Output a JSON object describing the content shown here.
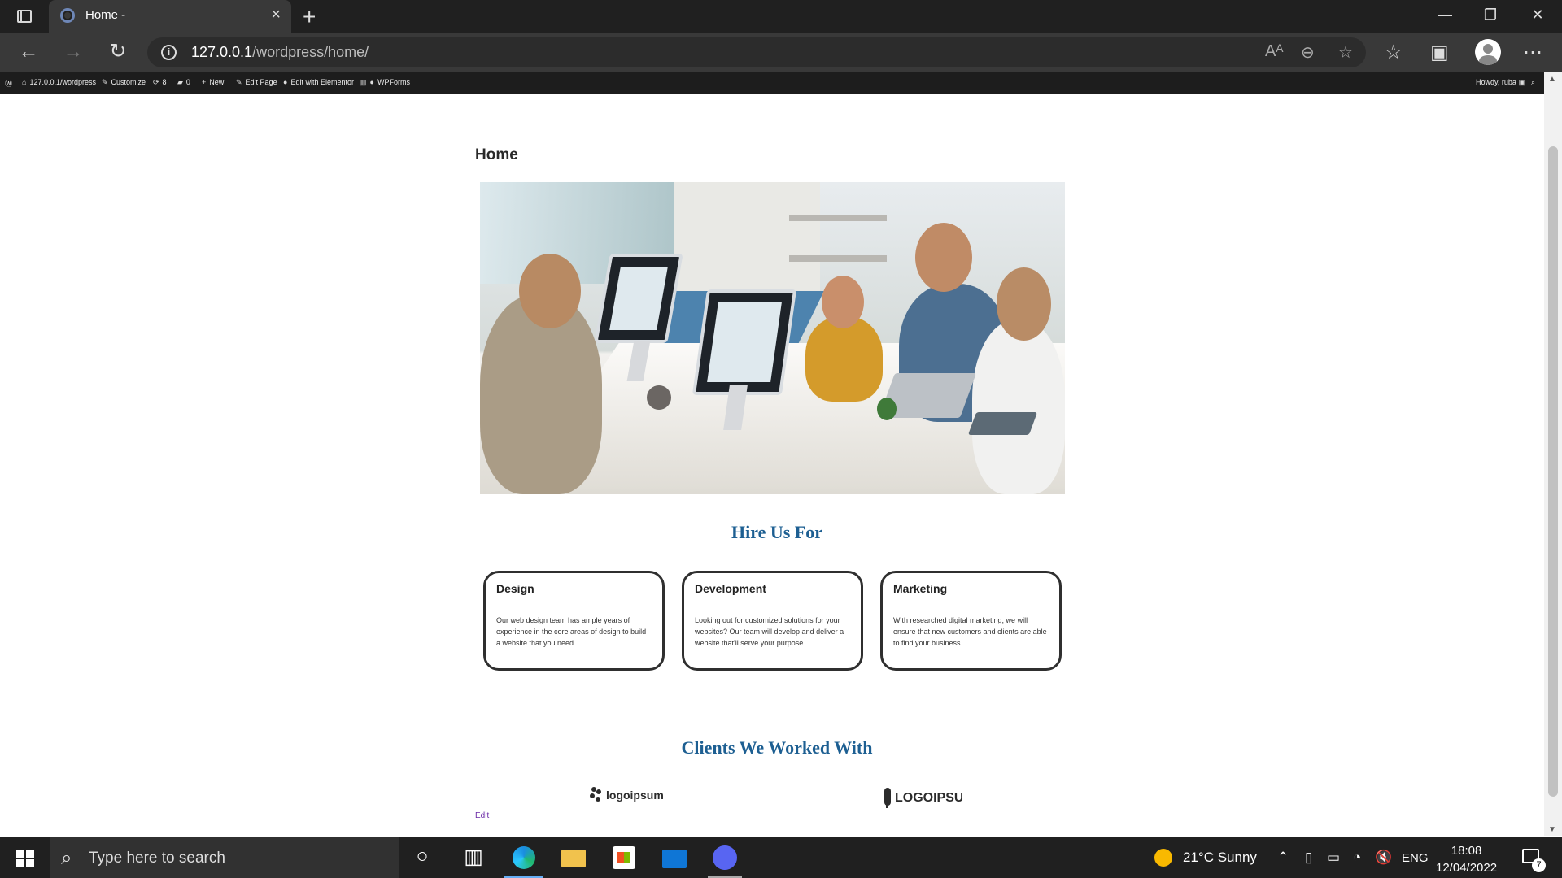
{
  "browser": {
    "tab_title": "Home -",
    "url_host": "127.0.0.1",
    "url_path": "/wordpress/home/"
  },
  "adminbar": {
    "site": "127.0.0.1/wordpress",
    "customize": "Customize",
    "updates": "8",
    "comments": "0",
    "new": "New",
    "edit_page": "Edit Page",
    "edit_elementor": "Edit with Elementor",
    "wpforms": "WPForms",
    "greeting": "Howdy, ruba"
  },
  "page": {
    "title": "Home",
    "hire_heading": "Hire Us For",
    "services": [
      {
        "title": "Design",
        "text": "Our web design team has ample years of experience in the core areas of design to build a website that you need."
      },
      {
        "title": "Development",
        "text": "Looking out for customized solutions for your websites? Our team will develop and deliver a website that'll serve your purpose."
      },
      {
        "title": "Marketing",
        "text": "With researched digital marketing, we will ensure that new customers and clients are able to find your business."
      }
    ],
    "clients_heading": "Clients We Worked With",
    "client_logos": [
      "logoipsum",
      "LOGOIPSUM"
    ],
    "edit_link": "Edit"
  },
  "taskbar": {
    "search_placeholder": "Type here to search",
    "weather": "21°C  Sunny",
    "language": "ENG",
    "time": "18:08",
    "date": "12/04/2022",
    "notifications": "7"
  }
}
